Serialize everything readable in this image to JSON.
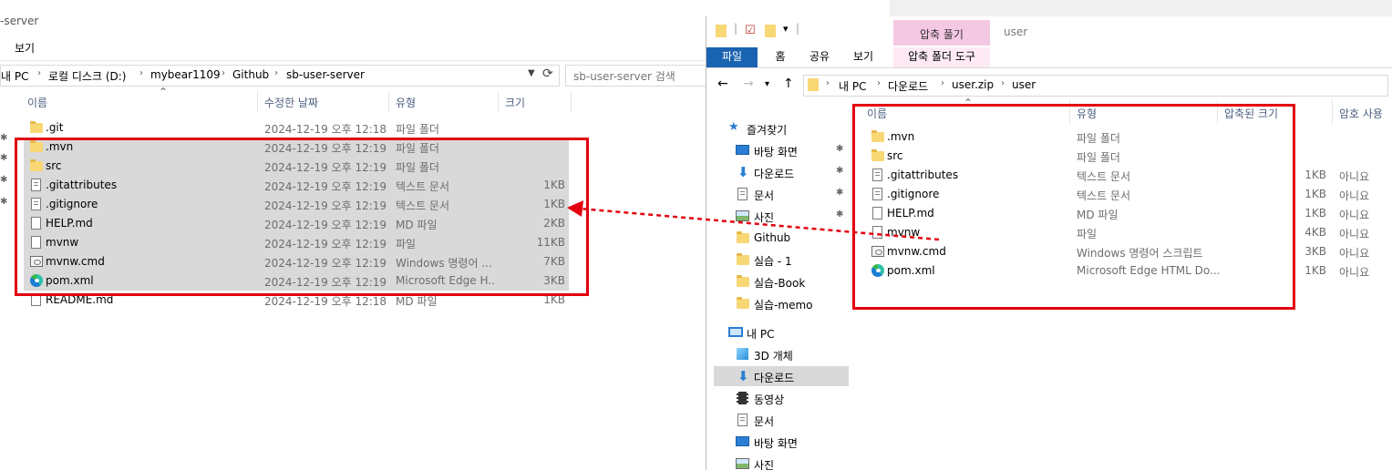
{
  "left_window": {
    "title_partial": "-server",
    "ribbon_tab": "보기",
    "breadcrumb": [
      "내 PC",
      "로컬 디스크 (D:)",
      "mybear1109",
      "Github",
      "sb-user-server"
    ],
    "search_placeholder": "sb-user-server 검색",
    "columns": [
      "이름",
      "수정한 날짜",
      "유형",
      "크기"
    ],
    "files": [
      {
        "name": ".git",
        "date": "2024-12-19 오후 12:18",
        "type": "파일 폴더",
        "size": "",
        "icon": "folder-icon",
        "selected": false
      },
      {
        "name": ".mvn",
        "date": "2024-12-19 오후 12:19",
        "type": "파일 폴더",
        "size": "",
        "icon": "folder-icon",
        "selected": true
      },
      {
        "name": "src",
        "date": "2024-12-19 오후 12:19",
        "type": "파일 폴더",
        "size": "",
        "icon": "folder-icon",
        "selected": true
      },
      {
        "name": ".gitattributes",
        "date": "2024-12-19 오후 12:19",
        "type": "텍스트 문서",
        "size": "1KB",
        "icon": "text-file-icon",
        "selected": true
      },
      {
        "name": ".gitignore",
        "date": "2024-12-19 오후 12:19",
        "type": "텍스트 문서",
        "size": "1KB",
        "icon": "text-file-icon",
        "selected": true
      },
      {
        "name": "HELP.md",
        "date": "2024-12-19 오후 12:19",
        "type": "MD 파일",
        "size": "2KB",
        "icon": "file-icon",
        "selected": true
      },
      {
        "name": "mvnw",
        "date": "2024-12-19 오후 12:19",
        "type": "파일",
        "size": "11KB",
        "icon": "file-icon",
        "selected": true
      },
      {
        "name": "mvnw.cmd",
        "date": "2024-12-19 오후 12:19",
        "type": "Windows 명령어 ...",
        "size": "7KB",
        "icon": "cmd-file-icon",
        "selected": true
      },
      {
        "name": "pom.xml",
        "date": "2024-12-19 오후 12:19",
        "type": "Microsoft Edge H...",
        "size": "3KB",
        "icon": "edge-icon",
        "selected": true
      },
      {
        "name": "README.md",
        "date": "2024-12-19 오후 12:18",
        "type": "MD 파일",
        "size": "1KB",
        "icon": "file-icon",
        "selected": false
      }
    ]
  },
  "right_window": {
    "title": "user",
    "context_tab": "압축 풀기",
    "tabs": [
      "파일",
      "홈",
      "공유",
      "보기",
      "압축 폴더 도구"
    ],
    "breadcrumb": [
      "내 PC",
      "다운로드",
      "user.zip",
      "user"
    ],
    "nav_items": [
      {
        "label": "즐겨찾기",
        "icon": "star-icon",
        "pinned": false,
        "active": false
      },
      {
        "label": "바탕 화면",
        "icon": "desktop-icon",
        "pinned": true,
        "active": false
      },
      {
        "label": "다운로드",
        "icon": "download-icon",
        "pinned": true,
        "active": false
      },
      {
        "label": "문서",
        "icon": "document-icon",
        "pinned": true,
        "active": false
      },
      {
        "label": "사진",
        "icon": "picture-icon",
        "pinned": true,
        "active": false
      },
      {
        "label": "Github",
        "icon": "folder-icon",
        "pinned": false,
        "active": false
      },
      {
        "label": "실습 - 1",
        "icon": "folder-icon",
        "pinned": false,
        "active": false
      },
      {
        "label": "실습-Book",
        "icon": "folder-icon",
        "pinned": false,
        "active": false
      },
      {
        "label": "실습-memo",
        "icon": "folder-icon",
        "pinned": false,
        "active": false
      },
      {
        "label": "내 PC",
        "icon": "computer-icon",
        "pinned": false,
        "active": false
      },
      {
        "label": "3D 개체",
        "icon": "cube-icon",
        "pinned": false,
        "active": false
      },
      {
        "label": "다운로드",
        "icon": "download-icon",
        "pinned": false,
        "active": true
      },
      {
        "label": "동영상",
        "icon": "video-icon",
        "pinned": false,
        "active": false
      },
      {
        "label": "문서",
        "icon": "document-icon",
        "pinned": false,
        "active": false
      },
      {
        "label": "바탕 화면",
        "icon": "desktop-icon",
        "pinned": false,
        "active": false
      },
      {
        "label": "사진",
        "icon": "picture-icon",
        "pinned": false,
        "active": false
      }
    ],
    "columns": [
      "이름",
      "유형",
      "압축된 크기",
      "암호 사용"
    ],
    "files": [
      {
        "name": ".mvn",
        "type": "파일 폴더",
        "size": "",
        "password": "",
        "icon": "folder-icon"
      },
      {
        "name": "src",
        "type": "파일 폴더",
        "size": "",
        "password": "",
        "icon": "folder-icon"
      },
      {
        "name": ".gitattributes",
        "type": "텍스트 문서",
        "size": "1KB",
        "password": "아니요",
        "icon": "text-file-icon"
      },
      {
        "name": ".gitignore",
        "type": "텍스트 문서",
        "size": "1KB",
        "password": "아니요",
        "icon": "text-file-icon"
      },
      {
        "name": "HELP.md",
        "type": "MD 파일",
        "size": "1KB",
        "password": "아니요",
        "icon": "file-icon"
      },
      {
        "name": "mvnw",
        "type": "파일",
        "size": "4KB",
        "password": "아니요",
        "icon": "file-icon"
      },
      {
        "name": "mvnw.cmd",
        "type": "Windows 명령어 스크립트",
        "size": "3KB",
        "password": "아니요",
        "icon": "cmd-file-icon"
      },
      {
        "name": "pom.xml",
        "type": "Microsoft Edge HTML Do...",
        "size": "1KB",
        "password": "아니요",
        "icon": "edge-icon"
      }
    ]
  },
  "colors": {
    "highlight_red": "#e3000f",
    "selection_gray": "#d9d9d9",
    "file_tab_blue": "#1a63b0",
    "context_tab_pink": "#f4c8e2"
  }
}
